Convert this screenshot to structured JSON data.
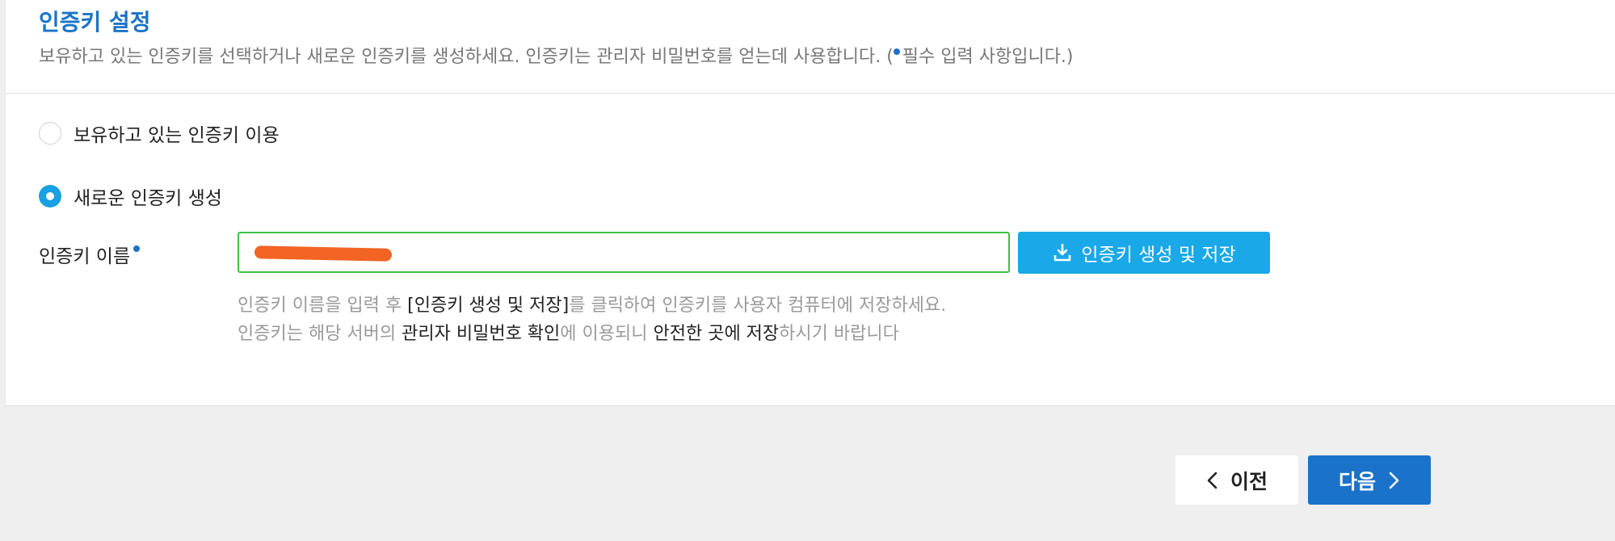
{
  "header": {
    "title": "인증키 설정",
    "description_pre": "보유하고 있는 인증키를 선택하거나 새로운 인증키를 생성하세요. 인증키는 관리자 비밀번호를 얻는데 사용합니다. (",
    "description_required": "필수 입력 사항입니다.)"
  },
  "options": {
    "existing_label": "보유하고 있는 인증키 이용",
    "existing_checked": false,
    "new_label": "새로운 인증키 생성",
    "new_checked": true
  },
  "key_name": {
    "label": "인증키 이름",
    "value": "",
    "value_redacted": true
  },
  "generate_button_label": "인증키 생성 및 저장",
  "help": {
    "line1_pre": "인증키 이름을 입력 후 ",
    "line1_em": "[인증키 생성 및 저장]",
    "line1_post": "를 클릭하여 인증키를 사용자 컴퓨터에 저장하세요.",
    "line2_pre": "인증키는 해당 서버의 ",
    "line2_em1": "관리자 비밀번호 확인",
    "line2_mid": "에 이용되니 ",
    "line2_em2": "안전한 곳에 저장",
    "line2_post": "하시기 바랍니다"
  },
  "footer": {
    "prev_label": "이전",
    "next_label": "다음"
  },
  "colors": {
    "accent": "#1a73c9",
    "button": "#19a8e8",
    "input_border": "#3fbf48",
    "redaction": "#f26424"
  },
  "icons": {
    "download": "download-icon",
    "prev": "chevron-left-icon",
    "next": "chevron-right-icon"
  }
}
